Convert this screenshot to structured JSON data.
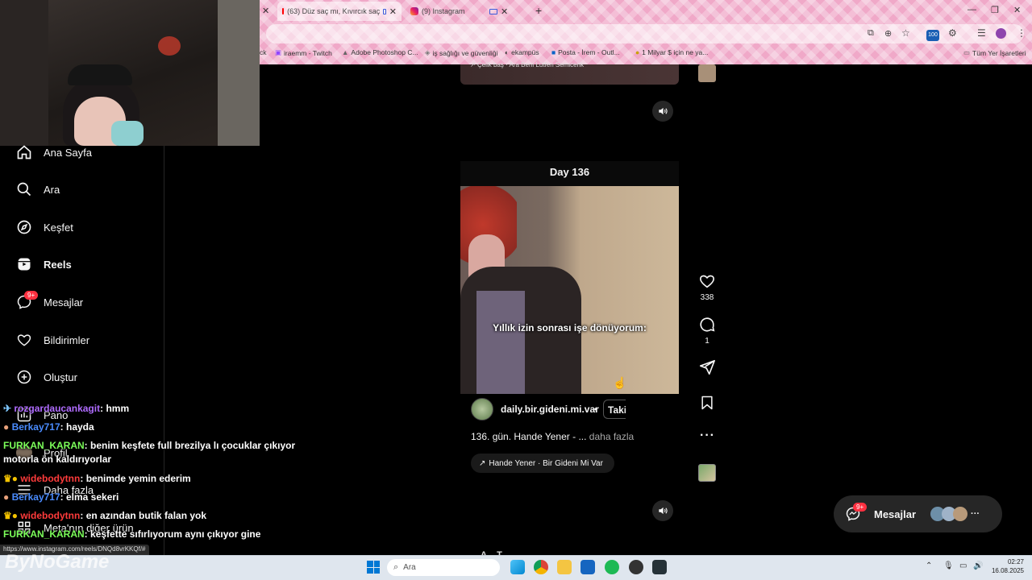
{
  "browser": {
    "tabs": [
      {
        "title": "(63) Düz saç mı, Kıvırcık saç"
      },
      {
        "title": "(9) Instagram"
      }
    ],
    "bookmarks": [
      "iraemm - Twitch",
      "Adobe Photoshop C...",
      "iş sağlığı ve güvenliği",
      "ekampüs",
      "Posta - İrem - Outl...",
      "1 Milyar $ için ne ya...",
      "Tüm Yer İşaretleri"
    ],
    "bookmark_fragment": "ck",
    "extension_badge": "100",
    "status_url": "https://www.instagram.com/reels/DNQd8vrKKQf/#"
  },
  "sidebar": {
    "items": [
      {
        "label": "Ana Sayfa",
        "icon": "home-icon"
      },
      {
        "label": "Ara",
        "icon": "search-icon"
      },
      {
        "label": "Keşfet",
        "icon": "compass-icon"
      },
      {
        "label": "Reels",
        "icon": "reels-icon",
        "active": true
      },
      {
        "label": "Mesajlar",
        "icon": "messenger-icon",
        "badge": "9+"
      },
      {
        "label": "Bildirimler",
        "icon": "heart-icon"
      },
      {
        "label": "Oluştur",
        "icon": "plus-square-icon"
      },
      {
        "label": "Pano",
        "icon": "dashboard-icon"
      },
      {
        "label": "Profil",
        "icon": "avatar"
      },
      {
        "label": "Daha fazla",
        "icon": "menu-icon"
      },
      {
        "label": "Meta'nın diğer ürün",
        "icon": "grid-icon"
      }
    ]
  },
  "chat": [
    {
      "user": "rozgardaucankagit",
      "color": "#b06cff",
      "msg": "hmm"
    },
    {
      "user": "Berkay717",
      "color": "#4a8cff",
      "msg": "hayda"
    },
    {
      "user": "FURKAN_KARAN",
      "color": "#7cff5a",
      "msg": "benim keşfete full brezilya lı çocuklar çıkıyor motorla ön kaldırıyorlar"
    },
    {
      "user": "widebodytnn",
      "color": "#ff3b3b",
      "msg": "benimde yemin ederim"
    },
    {
      "user": "Berkay717",
      "color": "#4a8cff",
      "msg": "elma sekeri"
    },
    {
      "user": "widebodytnn",
      "color": "#ff3b3b",
      "msg": "en azından butik falan yok"
    },
    {
      "user": "FURKAN_KARAN",
      "color": "#7cff5a",
      "msg": "keşfette sıfırlıyorum aynı çıkıyor gine"
    }
  ],
  "reel_prev": {
    "tag": "Çelik baş · Ara Beni Lütfen Semicenk"
  },
  "reel": {
    "title": "Day 136",
    "caption_overlay": "Yıllık izin sonrası işe dönüyorum:",
    "username": "daily.bir.gideni.mi.var",
    "dot": "•",
    "follow": "Takip et",
    "description": "136. gün. Hande Yener - ...",
    "more": "daha fazla",
    "audio": "Hande Yener · Bir Gideni Mi Var",
    "likes": "338",
    "comments": "1"
  },
  "next_reel_partial": "A... T... ... ... ...",
  "messages_pill": {
    "label": "Mesajlar",
    "badge": "9+"
  },
  "taskbar": {
    "search_placeholder": "Ara",
    "time": "02:27",
    "date": "16.08.2025"
  },
  "watermark": "ByNoGame"
}
